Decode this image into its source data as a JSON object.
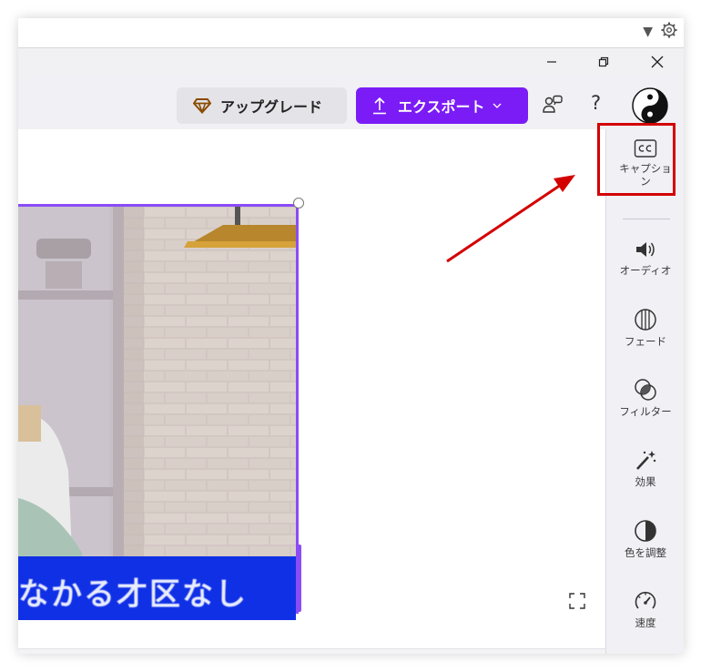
{
  "topstrip": {
    "dropdown_icon": "triangle-down-icon",
    "settings_icon": "gear-icon"
  },
  "titlebar": {
    "minimize_icon": "minimize-icon",
    "restore_icon": "restore-icon",
    "close_icon": "close-icon"
  },
  "toolbar": {
    "upgrade_label": "アップグレード",
    "upgrade_icon": "diamond-icon",
    "export_label": "エクスポート",
    "export_icon": "upload-icon",
    "collaborate_icon": "people-icon",
    "help_label": "?",
    "avatar_icon": "yin-yang-icon"
  },
  "canvas": {
    "caption_text": "なかる才区なし",
    "fullscreen_icon": "fullscreen-icon"
  },
  "sidebar": {
    "items": [
      {
        "label": "キャプション",
        "icon": "cc-icon"
      },
      {
        "label": "オーディオ",
        "icon": "speaker-icon"
      },
      {
        "label": "フェード",
        "icon": "fade-icon"
      },
      {
        "label": "フィルター",
        "icon": "filter-icon"
      },
      {
        "label": "効果",
        "icon": "magic-wand-icon"
      },
      {
        "label": "色を調整",
        "icon": "contrast-icon"
      },
      {
        "label": "速度",
        "icon": "speedometer-icon"
      }
    ]
  },
  "colors": {
    "accent": "#7b1cf6",
    "annotation": "#d40000",
    "caption_bg": "#1030e6"
  }
}
